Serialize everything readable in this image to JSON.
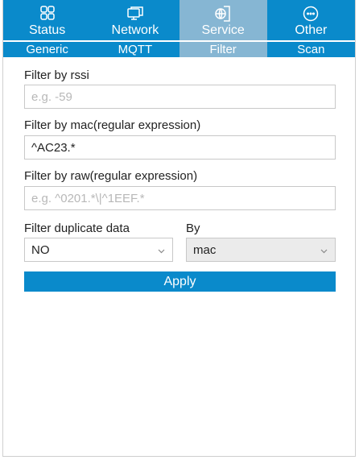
{
  "topnav": {
    "tabs": [
      {
        "label": "Status",
        "icon": "grid-icon"
      },
      {
        "label": "Network",
        "icon": "monitor-icon"
      },
      {
        "label": "Service",
        "icon": "globe-doc-icon"
      },
      {
        "label": "Other",
        "icon": "ellipsis-circle-icon"
      }
    ],
    "active_index": 2
  },
  "subnav": {
    "tabs": [
      "Generic",
      "MQTT",
      "Filter",
      "Scan"
    ],
    "active_index": 2
  },
  "form": {
    "rssi": {
      "label": "Filter by rssi",
      "value": "",
      "placeholder": "e.g. -59"
    },
    "mac": {
      "label": "Filter by mac(regular expression)",
      "value": "^AC23.*",
      "placeholder": ""
    },
    "raw": {
      "label": "Filter by raw(regular expression)",
      "value": "",
      "placeholder": "e.g. ^0201.*\\|^1EEF.*"
    },
    "duplicate": {
      "label": "Filter duplicate data",
      "value": "NO"
    },
    "by": {
      "label": "By",
      "value": "mac"
    },
    "apply_label": "Apply"
  },
  "colors": {
    "accent": "#0a8acb",
    "active_tab": "#86b6d3"
  }
}
